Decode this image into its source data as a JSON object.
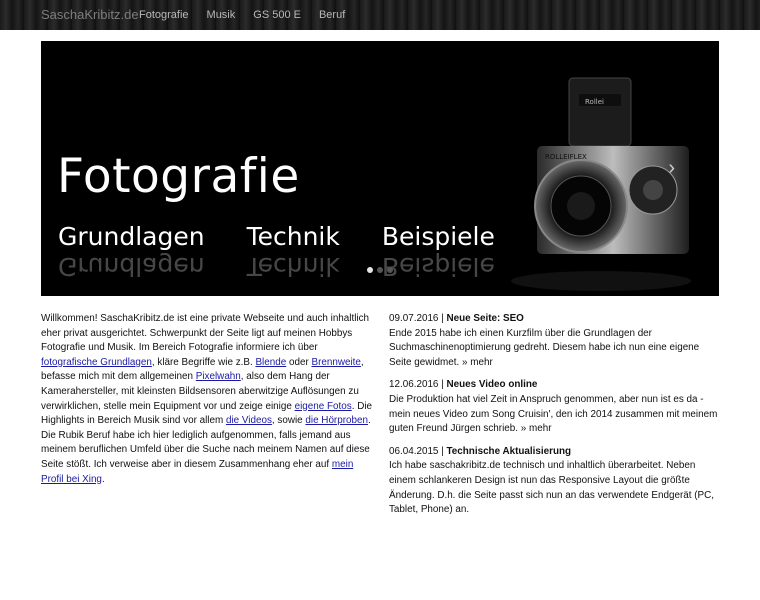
{
  "header": {
    "brand": "SaschaKribitz.de",
    "nav": [
      "Fotografie",
      "Musik",
      "GS 500 E",
      "Beruf"
    ]
  },
  "slider": {
    "title": "Fotografie",
    "topics": [
      "Grundlagen",
      "Technik",
      "Beispiele"
    ],
    "camera_brand": "ROLLEIFLEX",
    "camera_label": "Rollei",
    "next_arrow": "›",
    "dots": 3,
    "active_dot": 0
  },
  "intro": {
    "parts": [
      "Willkommen! SaschaKribitz.de ist eine private Webseite und auch inhaltlich eher privat ausgerichtet. Schwerpunkt der Seite ligt auf meinen Hobbys Fotografie und Musik. Im Bereich Fotografie informiere ich über ",
      "fotografische Grundlagen",
      ", kläre Begriffe wie z.B. ",
      "Blende",
      " oder ",
      "Brennweite",
      ", befasse mich mit dem allgemeinen ",
      "Pixelwahn",
      ", also dem Hang der Kamerahersteller, mit kleinsten Bildsensoren aberwitzige Auflösungen zu verwirklichen, stelle mein Equipment vor und zeige einige ",
      "eigene Fotos",
      ". Die Highlights in Bereich Musik sind vor allem ",
      "die Videos",
      ", sowie ",
      "die Hörproben",
      ". Die Rubik Beruf habe ich hier lediglich aufgenommen, falls jemand aus meinem beruflichen Umfeld über die Suche nach meinem Namen auf diese Seite stößt. Ich verweise aber in diesem Zusammenhang eher auf ",
      "mein Profil bei Xing",
      "."
    ]
  },
  "news": [
    {
      "date": "09.07.2016 | ",
      "title": "Neue Seite: SEO",
      "text": "Ende 2015 habe ich einen Kurzfilm über die Grundlagen der Suchmaschinenoptimierung gedreht. Diesem habe ich nun eine eigene Seite gewidmet.",
      "more": "» mehr"
    },
    {
      "date": "12.06.2016 | ",
      "title": "Neues Video online",
      "text": "Die Produktion hat viel Zeit in Anspruch genommen, aber nun ist es da - mein neues Video zum Song Cruisin', den ich 2014 zusammen mit meinem guten Freund Jürgen schrieb.",
      "more": "» mehr"
    },
    {
      "date": "06.04.2015 | ",
      "title": "Technische Aktualisierung",
      "text": "Ich habe saschakribitz.de technisch und inhaltlich überarbeitet. Neben einem schlankeren Design ist nun das Responsive Layout die größte Änderung. D.h. die Seite passt sich nun an das verwendete Endgerät (PC, Tablet, Phone) an.",
      "more": ""
    }
  ]
}
